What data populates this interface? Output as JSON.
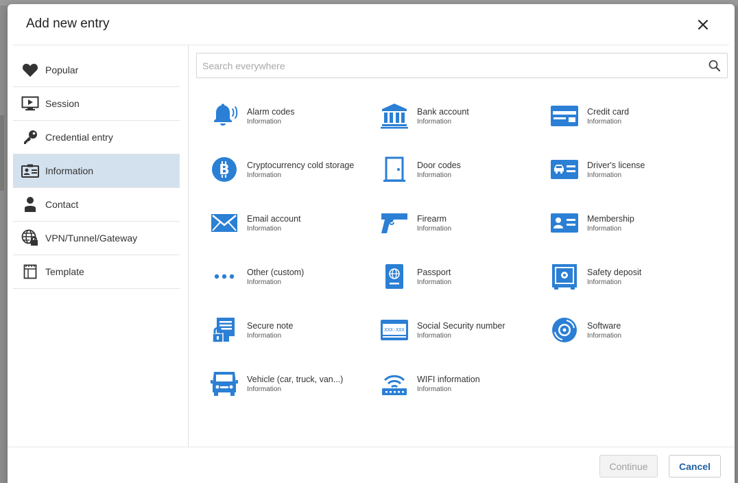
{
  "dialog": {
    "title": "Add new entry"
  },
  "search": {
    "placeholder": "Search everywhere",
    "value": ""
  },
  "sidebar": {
    "items": [
      {
        "label": "Popular",
        "icon": "heart-icon",
        "active": false
      },
      {
        "label": "Session",
        "icon": "monitor-play-icon",
        "active": false
      },
      {
        "label": "Credential entry",
        "icon": "key-icon",
        "active": false
      },
      {
        "label": "Information",
        "icon": "id-card-icon",
        "active": true
      },
      {
        "label": "Contact",
        "icon": "person-icon",
        "active": false
      },
      {
        "label": "VPN/Tunnel/Gateway",
        "icon": "globe-lock-icon",
        "active": false
      },
      {
        "label": "Template",
        "icon": "template-icon",
        "active": false
      }
    ]
  },
  "entries": [
    {
      "name": "Alarm codes",
      "sub": "Information",
      "icon": "alarm-bell-icon"
    },
    {
      "name": "Bank account",
      "sub": "Information",
      "icon": "bank-icon"
    },
    {
      "name": "Credit card",
      "sub": "Information",
      "icon": "credit-card-icon"
    },
    {
      "name": "Cryptocurrency cold storage",
      "sub": "Information",
      "icon": "bitcoin-icon"
    },
    {
      "name": "Door codes",
      "sub": "Information",
      "icon": "door-icon"
    },
    {
      "name": "Driver's license",
      "sub": "Information",
      "icon": "drivers-license-icon"
    },
    {
      "name": "Email account",
      "sub": "Information",
      "icon": "envelope-icon"
    },
    {
      "name": "Firearm",
      "sub": "Information",
      "icon": "firearm-icon"
    },
    {
      "name": "Membership",
      "sub": "Information",
      "icon": "membership-card-icon"
    },
    {
      "name": "Other (custom)",
      "sub": "Information",
      "icon": "ellipsis-icon"
    },
    {
      "name": "Passport",
      "sub": "Information",
      "icon": "passport-icon"
    },
    {
      "name": "Safety deposit",
      "sub": "Information",
      "icon": "safe-icon"
    },
    {
      "name": "Secure note",
      "sub": "Information",
      "icon": "secure-note-icon"
    },
    {
      "name": "Social Security number",
      "sub": "Information",
      "icon": "ssn-card-icon"
    },
    {
      "name": "Software",
      "sub": "Information",
      "icon": "software-disc-icon"
    },
    {
      "name": "Vehicle (car, truck, van...)",
      "sub": "Information",
      "icon": "vehicle-icon"
    },
    {
      "name": "WIFI information",
      "sub": "Information",
      "icon": "wifi-router-icon"
    }
  ],
  "footer": {
    "continue_label": "Continue",
    "cancel_label": "Cancel"
  },
  "colors": {
    "accent_blue": "#2b7fd4",
    "active_item_bg": "#d3e1ee",
    "cancel_text": "#1f5fa3"
  }
}
